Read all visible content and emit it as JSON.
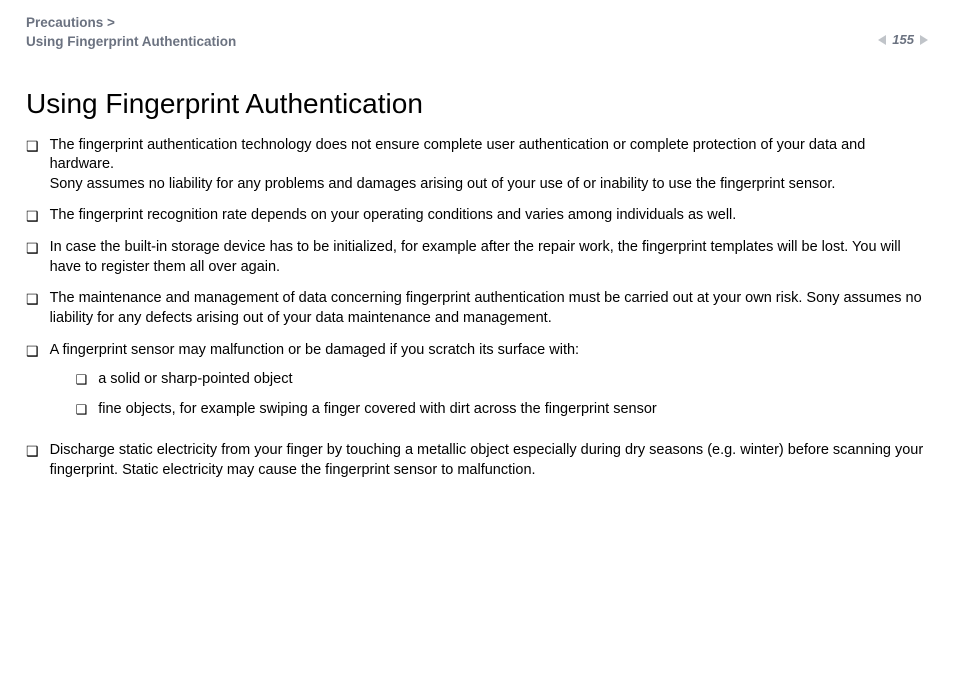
{
  "breadcrumb": {
    "line1": "Precautions >",
    "line2": "Using Fingerprint Authentication"
  },
  "page_number": "155",
  "title": "Using Fingerprint Authentication",
  "bullets": [
    {
      "text": "The fingerprint authentication technology does not ensure complete user authentication or complete protection of your data and hardware.\nSony assumes no liability for any problems and damages arising out of your use of or inability to use the fingerprint sensor."
    },
    {
      "text": "The fingerprint recognition rate depends on your operating conditions and varies among individuals as well."
    },
    {
      "text": "In case the built-in storage device has to be initialized, for example after the repair work, the fingerprint templates will be lost. You will have to register them all over again."
    },
    {
      "text": "The maintenance and management of data concerning fingerprint authentication must be carried out at your own risk. Sony assumes no liability for any defects arising out of your data maintenance and management."
    },
    {
      "text": "A fingerprint sensor may malfunction or be damaged if you scratch its surface with:",
      "sub": [
        "a solid or sharp-pointed object",
        "fine objects, for example swiping a finger covered with dirt across the fingerprint sensor"
      ]
    },
    {
      "text": "Discharge static electricity from your finger by touching a metallic object especially during dry seasons (e.g. winter) before scanning your fingerprint. Static electricity may cause the fingerprint sensor to malfunction."
    }
  ]
}
